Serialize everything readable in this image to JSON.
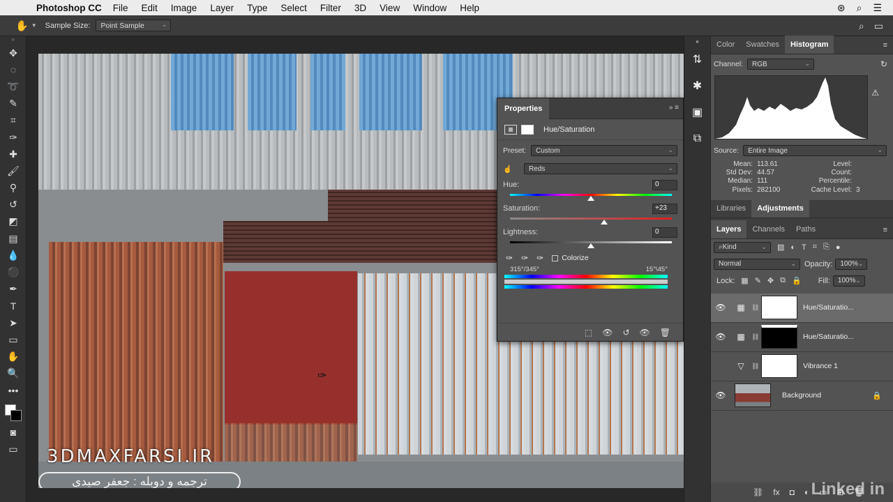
{
  "menubar": {
    "app_name": "Photoshop CC",
    "items": [
      "File",
      "Edit",
      "Image",
      "Layer",
      "Type",
      "Select",
      "Filter",
      "3D",
      "View",
      "Window",
      "Help"
    ]
  },
  "options_bar": {
    "sample_size_label": "Sample Size:",
    "sample_size_value": "Point Sample"
  },
  "properties": {
    "tab": "Properties",
    "adjustment_title": "Hue/Saturation",
    "preset_label": "Preset:",
    "preset_value": "Custom",
    "channel_value": "Reds",
    "hue_label": "Hue:",
    "hue_value": "0",
    "saturation_label": "Saturation:",
    "saturation_value": "+23",
    "lightness_label": "Lightness:",
    "lightness_value": "0",
    "colorize_label": "Colorize",
    "range_left": "315°/345°",
    "range_right": "15°\\45°",
    "hue_level": 0.5,
    "saturation_level": 0.58,
    "lightness_level": 0.5
  },
  "histogram_panel": {
    "tabs": [
      "Color",
      "Swatches",
      "Histogram"
    ],
    "active_tab": "Histogram",
    "channel_label": "Channel:",
    "channel_value": "RGB",
    "source_label": "Source:",
    "source_value": "Entire Image",
    "stats": {
      "mean_label": "Mean:",
      "mean": "113.61",
      "stddev_label": "Std Dev:",
      "stddev": "44.57",
      "median_label": "Median:",
      "median": "111",
      "pixels_label": "Pixels:",
      "pixels": "282100",
      "level_label": "Level:",
      "level": "",
      "count_label": "Count:",
      "count": "",
      "percentile_label": "Percentile:",
      "percentile": "",
      "cache_label": "Cache Level:",
      "cache": "3"
    }
  },
  "lib_adj_tabs": [
    "Libraries",
    "Adjustments"
  ],
  "layers_panel": {
    "tabs": [
      "Layers",
      "Channels",
      "Paths"
    ],
    "filter_value": "Kind",
    "blend_mode": "Normal",
    "opacity_label": "Opacity:",
    "opacity_value": "100%",
    "lock_label": "Lock:",
    "fill_label": "Fill:",
    "fill_value": "100%",
    "layers": [
      {
        "name": "Hue/Saturatio...",
        "visible": true,
        "selected": true,
        "mask": "#ffffff"
      },
      {
        "name": "Hue/Saturatio...",
        "visible": true,
        "selected": false,
        "mask": "#000000"
      },
      {
        "name": "Vibrance 1",
        "visible": false,
        "selected": false,
        "mask": "#ffffff"
      },
      {
        "name": "Background",
        "visible": true,
        "selected": false,
        "mask": "photo"
      }
    ]
  },
  "watermarks": {
    "site": "3DMAXFARSI.IR",
    "credit": "ترجمه و دوبله : جعفر صیدی",
    "brand": "Linked in"
  },
  "colors": {
    "panel_bg": "#535353",
    "app_bg": "#282828",
    "selected_row": "#6b6b6b"
  }
}
